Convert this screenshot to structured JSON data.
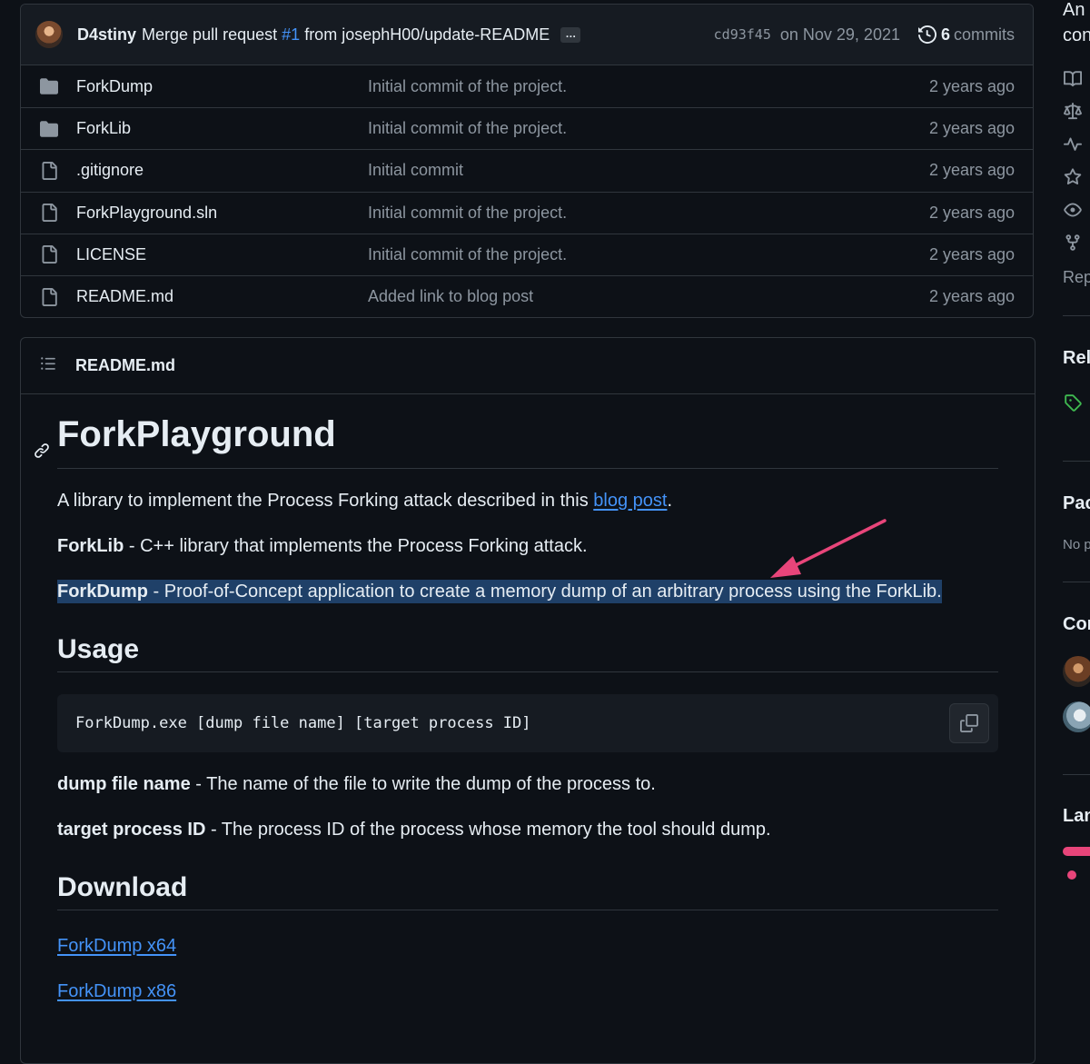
{
  "commit": {
    "author": "D4stiny",
    "message_prefix": "Merge pull request",
    "pr_number": "#1",
    "message_suffix": "from josephH00/update-README",
    "ellipsis": "…",
    "sha": "cd93f45",
    "date": "on Nov 29, 2021",
    "commit_count": "6",
    "commits_label": "commits"
  },
  "files": [
    {
      "type": "folder",
      "name": "ForkDump",
      "message": "Initial commit of the project.",
      "age": "2 years ago"
    },
    {
      "type": "folder",
      "name": "ForkLib",
      "message": "Initial commit of the project.",
      "age": "2 years ago"
    },
    {
      "type": "file",
      "name": ".gitignore",
      "message": "Initial commit",
      "age": "2 years ago"
    },
    {
      "type": "file",
      "name": "ForkPlayground.sln",
      "message": "Initial commit of the project.",
      "age": "2 years ago"
    },
    {
      "type": "file",
      "name": "LICENSE",
      "message": "Initial commit of the project.",
      "age": "2 years ago"
    },
    {
      "type": "file",
      "name": "README.md",
      "message": "Added link to blog post",
      "age": "2 years ago"
    }
  ],
  "readme": {
    "filename": "README.md",
    "title": "ForkPlayground",
    "intro_text": "A library to implement the Process Forking attack described in this ",
    "intro_link": "blog post",
    "intro_end": ".",
    "forklib_bold": "ForkLib",
    "forklib_text": " - C++ library that implements the Process Forking attack.",
    "forkdump_bold": "ForkDump",
    "forkdump_text": " - Proof-of-Concept application to create a memory dump of an arbitrary process using the ForkLib.",
    "usage_heading": "Usage",
    "code": "ForkDump.exe [dump file name] [target process ID]",
    "dump_bold": "dump file name",
    "dump_text": " - The name of the file to write the dump of the process to.",
    "target_bold": "target process ID",
    "target_text": " - The process ID of the process whose memory the tool should dump.",
    "download_heading": "Download",
    "download_x64": "ForkDump x64",
    "download_x86": "ForkDump x86"
  },
  "sidebar": {
    "about_line1": "An",
    "about_line2": "con",
    "repo_label": "Rep",
    "releases_heading": "Rel",
    "packages_heading": "Pac",
    "packages_text": "No p",
    "contributors_heading": "Cor",
    "languages_heading": "Lan"
  },
  "colors": {
    "background": "#0d1117",
    "border": "#30363d",
    "link": "#4493f8",
    "muted": "#8d96a0",
    "selection": "#1f4068",
    "annotation_arrow": "#e8457a",
    "tag_green": "#3fb950"
  },
  "icons": [
    "folder-icon",
    "file-icon",
    "history-icon",
    "list-icon",
    "link-icon",
    "copy-icon",
    "book-icon",
    "scale-icon",
    "pulse-icon",
    "star-icon",
    "eye-icon",
    "fork-icon",
    "tag-icon"
  ]
}
